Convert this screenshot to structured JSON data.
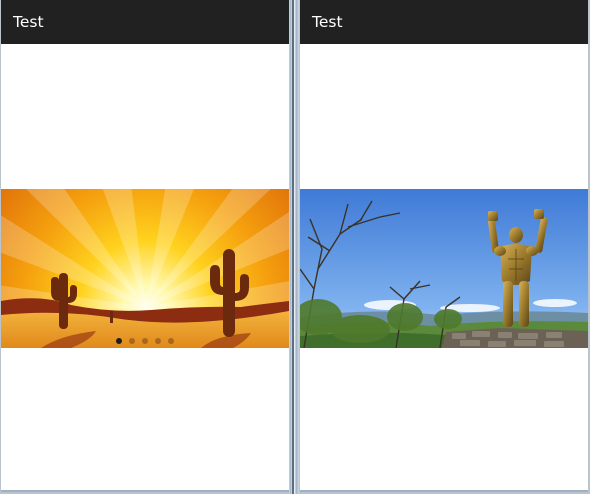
{
  "left_screen": {
    "appbar": {
      "title": "Test"
    },
    "slider": {
      "image": "desert-sunset-cactus-illustration",
      "indicator_count": 5,
      "active_index": 0
    }
  },
  "right_screen": {
    "appbar": {
      "title": "Test"
    },
    "slider": {
      "image": "bronze-statue-arms-raised-landscape"
    }
  },
  "colors": {
    "appbar_bg": "#212121",
    "appbar_text": "#ffffff",
    "sky_blue": "#4a83d8",
    "desert_orange": "#e97b12"
  }
}
